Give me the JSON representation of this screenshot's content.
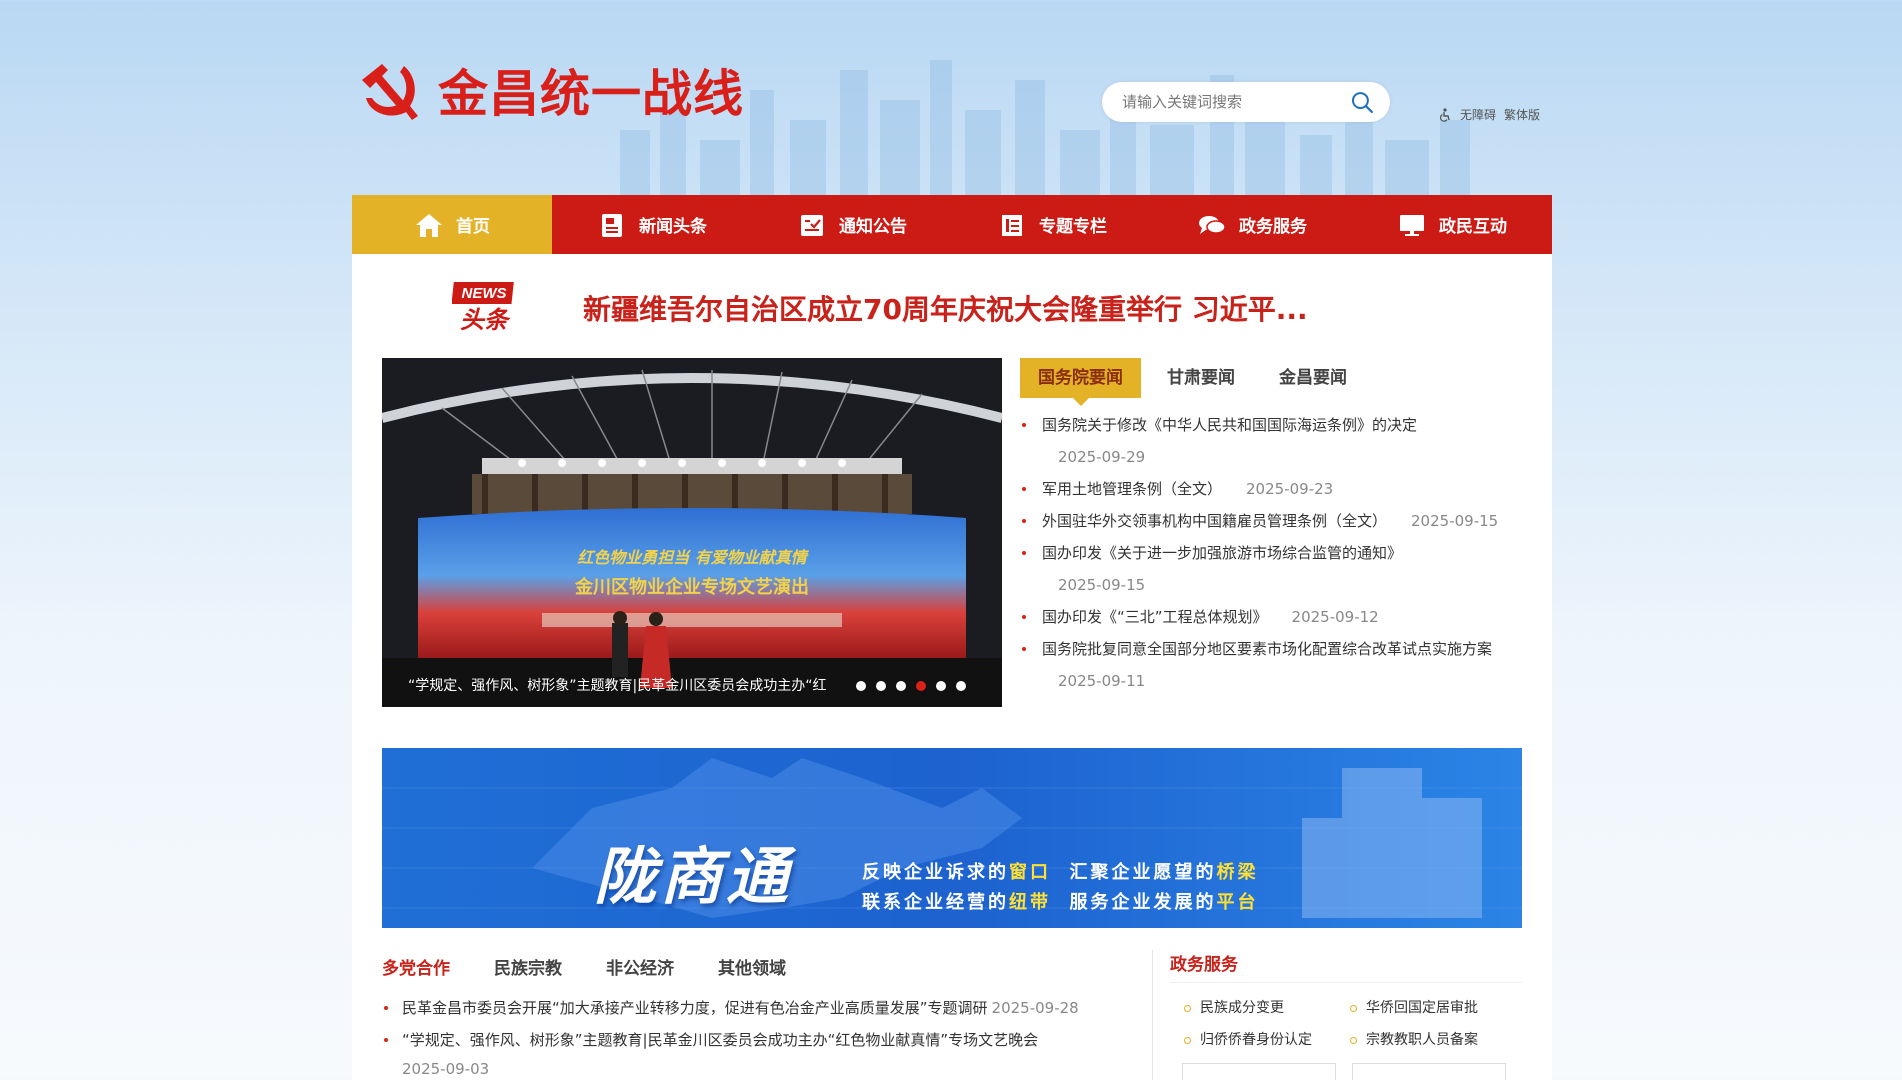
{
  "site": {
    "title": "金昌统一战线",
    "search_placeholder": "请输入关键词搜索",
    "accessibility": "无障碍",
    "traditional": "繁体版"
  },
  "nav": [
    {
      "label": "首页",
      "icon": "home-icon"
    },
    {
      "label": "新闻头条",
      "icon": "news-icon"
    },
    {
      "label": "通知公告",
      "icon": "notice-icon"
    },
    {
      "label": "专题专栏",
      "icon": "column-icon"
    },
    {
      "label": "政务服务",
      "icon": "chat-icon"
    },
    {
      "label": "政民互动",
      "icon": "monitor-icon"
    }
  ],
  "headline": {
    "badge_top": "NEWS",
    "badge_bottom": "头条",
    "text": "新疆维吾尔自治区成立70周年庆祝大会隆重举行 习近平..."
  },
  "slider": {
    "caption": "“学规定、强作风、树形象”主题教育|民革金川区委员会成功主办“红",
    "stage_line1": "红色物业勇担当 有爱物业献真情",
    "stage_line2": "金川区物业企业专场文艺演出",
    "dot_count": 6,
    "active_dot": 3
  },
  "tabs": [
    "国务院要闻",
    "甘肃要闻",
    "金昌要闻"
  ],
  "news": [
    {
      "title": "国务院关于修改《中华人民共和国国际海运条例》的决定",
      "date": "2025-09-29",
      "wrap": true
    },
    {
      "title": "军用土地管理条例（全文）",
      "date": "2025-09-23",
      "wrap": false
    },
    {
      "title": "外国驻华外交领事机构中国籍雇员管理条例（全文）",
      "date": "2025-09-15",
      "wrap": false
    },
    {
      "title": "国办印发《关于进一步加强旅游市场综合监管的通知》",
      "date": "2025-09-15",
      "wrap": true
    },
    {
      "title": "国办印发《“三北”工程总体规划》",
      "date": "2025-09-12",
      "wrap": false
    },
    {
      "title": "国务院批复同意全国部分地区要素市场化配置综合改革试点实施方案",
      "date": "2025-09-11",
      "wrap": true
    }
  ],
  "banner": {
    "title": "陇商通",
    "line1": [
      "反映企业诉求的",
      "窗口",
      "汇聚企业愿望的",
      "桥梁"
    ],
    "line2": [
      "联系企业经营的",
      "纽带",
      "服务企业发展的",
      "平台"
    ]
  },
  "bottom_tabs": [
    "多党合作",
    "民族宗教",
    "非公经济",
    "其他领域"
  ],
  "bottom_news": [
    {
      "title": "民革金昌市委员会开展“加大承接产业转移力度，促进有色冶金产业高质量发展”专题调研",
      "date": "2025-09-28",
      "wrap": false
    },
    {
      "title": "“学规定、强作风、树形象”主题教育|民革金川区委员会成功主办“红色物业献真情”专场文艺晚会",
      "date": "2025-09-03",
      "wrap": true
    }
  ],
  "services": {
    "title": "政务服务",
    "items": [
      "民族成分变更",
      "华侨回国定居审批",
      "归侨侨眷身份认定",
      "宗教教职人员备案"
    ]
  },
  "colors": {
    "primary_red": "#cc1a14",
    "accent_gold": "#e3b227",
    "headline_red": "#c8221a"
  }
}
